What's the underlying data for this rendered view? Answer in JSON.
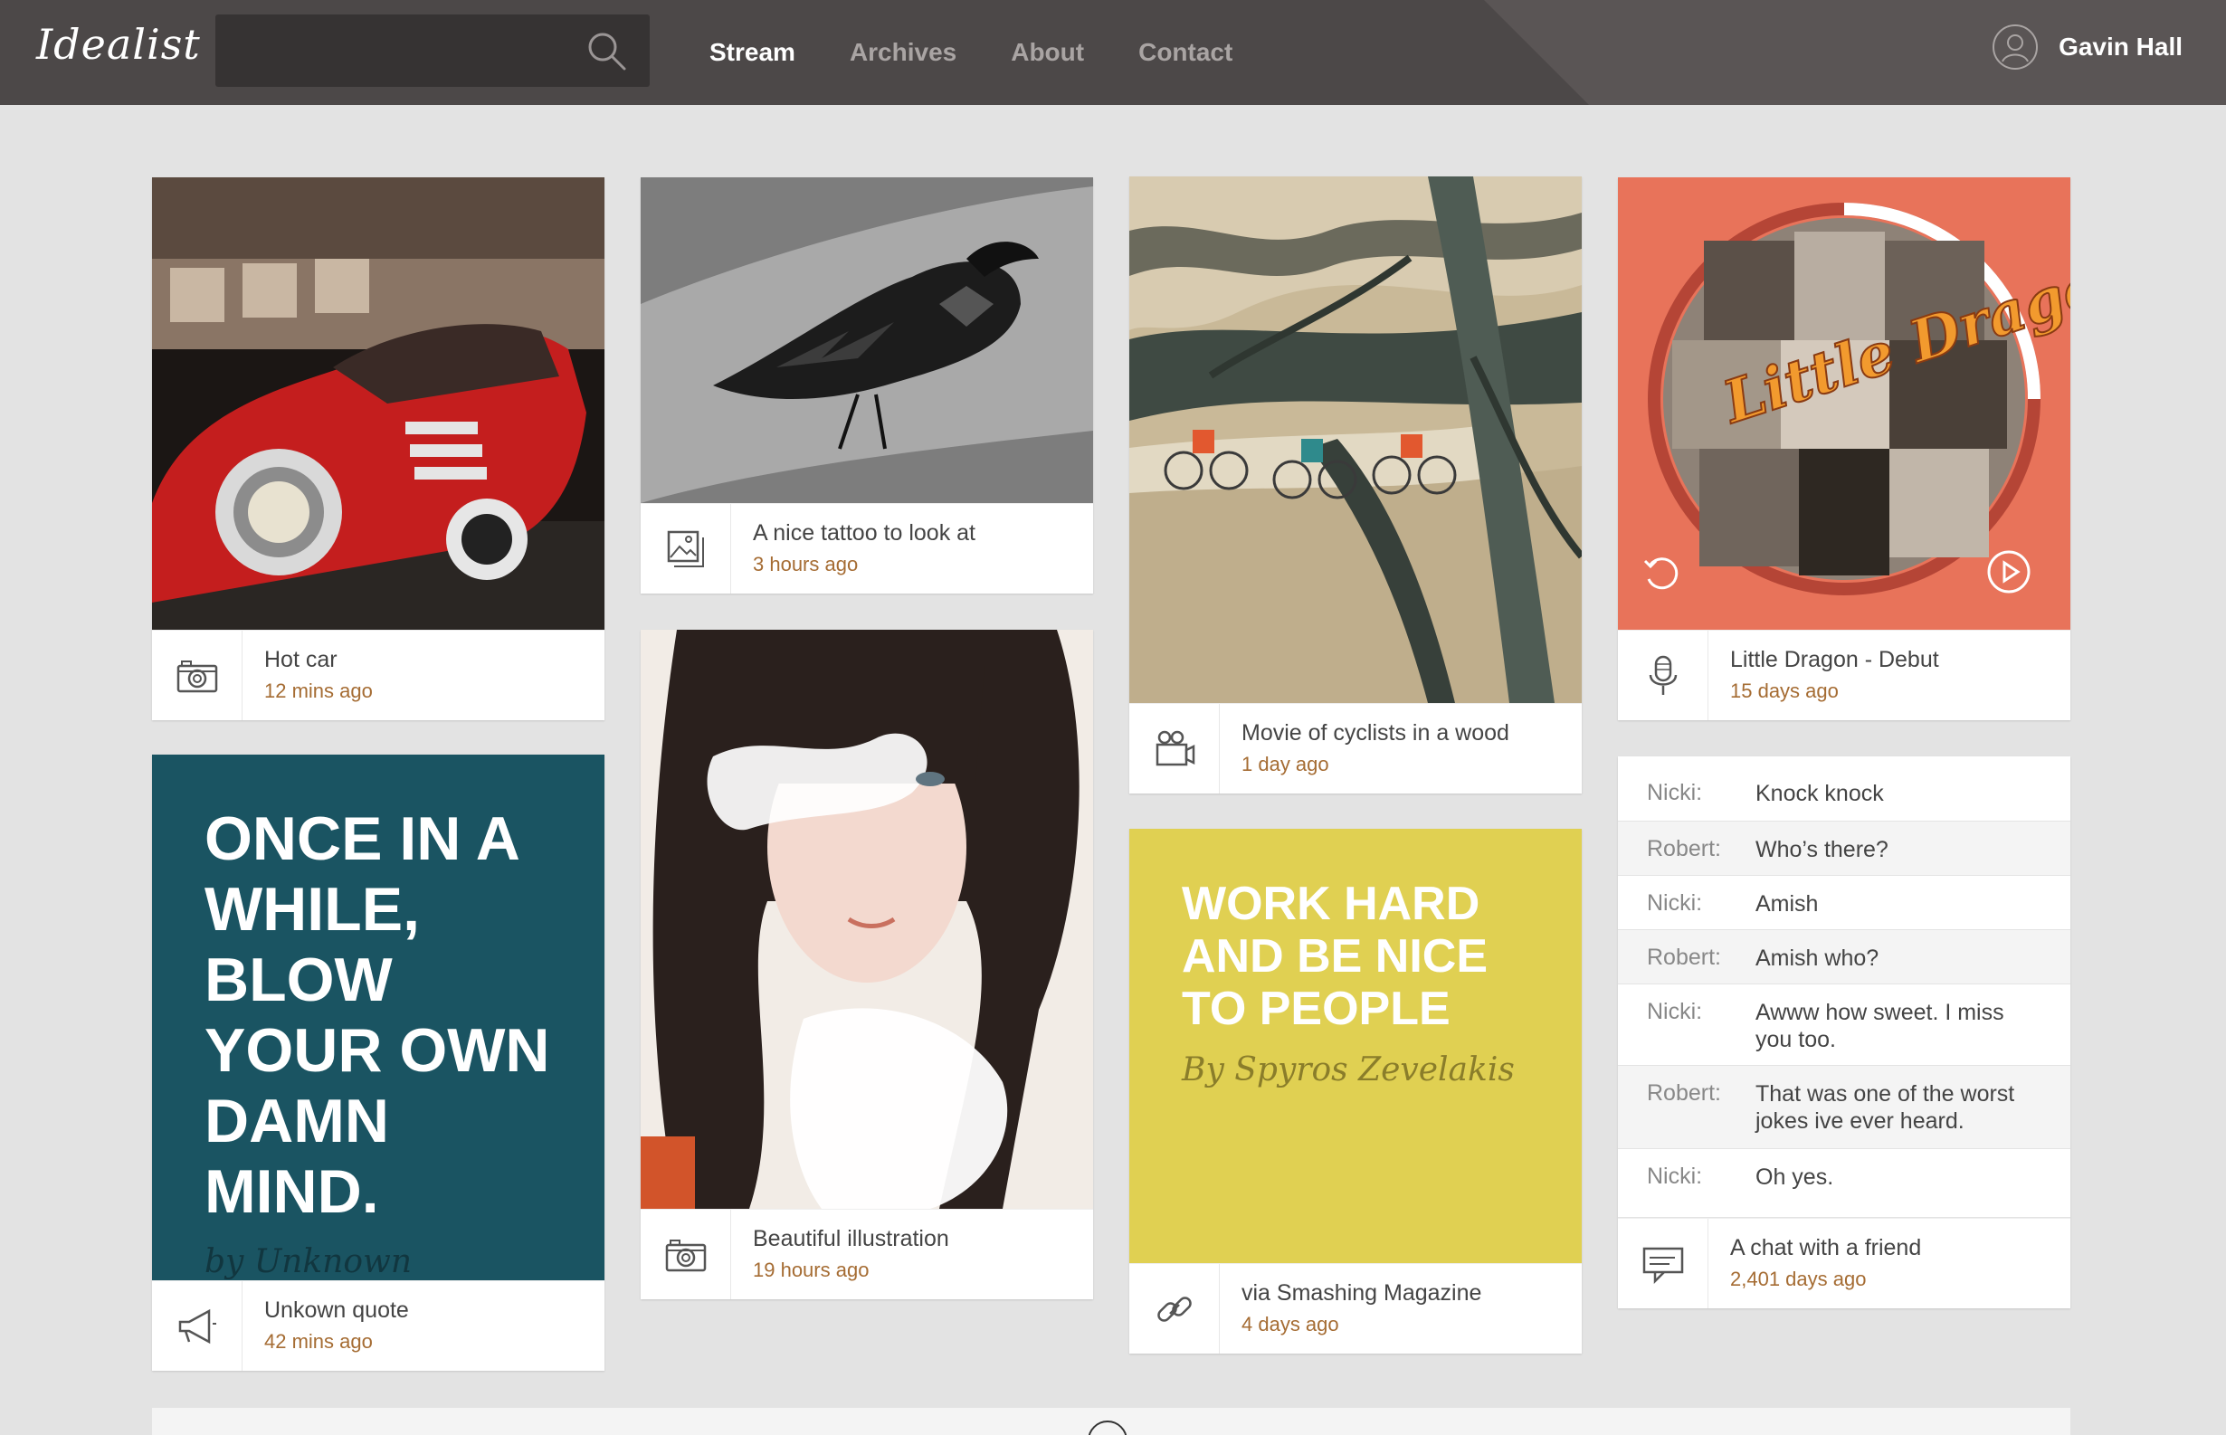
{
  "app": {
    "logo": "Idealist",
    "search": {
      "placeholder": "",
      "value": ""
    },
    "nav": [
      {
        "label": "Stream",
        "active": true
      },
      {
        "label": "Archives",
        "active": false
      },
      {
        "label": "About",
        "active": false
      },
      {
        "label": "Contact",
        "active": false
      }
    ],
    "user": {
      "name": "Gavin Hall"
    }
  },
  "cards": {
    "hot_car": {
      "title": "Hot car",
      "time": "12 mins ago",
      "icon": "camera-icon"
    },
    "tattoo": {
      "title": "A nice tattoo to look at",
      "time": "3 hours ago",
      "icon": "image-icon"
    },
    "cyclists": {
      "title": "Movie of cyclists in a wood",
      "time": "1 day ago",
      "icon": "video-camera-icon"
    },
    "little_dragon": {
      "title": "Little Dragon - Debut",
      "time": "15 days ago",
      "icon": "microphone-icon",
      "album_text": "Little Dragon"
    },
    "quote_unknown": {
      "quote": "ONCE IN A WHILE, BLOW YOUR OWN DAMN MIND.",
      "author": "by Unknown",
      "title": "Unkown quote",
      "time": "42 mins ago",
      "icon": "megaphone-icon",
      "color": "#1a5462"
    },
    "illustration": {
      "title": "Beautiful illustration",
      "time": "19 hours ago",
      "icon": "camera-icon"
    },
    "work_hard": {
      "quote": "WORK HARD AND BE NICE TO PEOPLE",
      "author": "By Spyros Zevelakis",
      "title": "via Smashing Magazine",
      "time": "4 days ago",
      "icon": "link-icon",
      "color": "#e0d052"
    },
    "chat": {
      "lines": [
        {
          "who": "Nicki:",
          "msg": "Knock knock"
        },
        {
          "who": "Robert:",
          "msg": "Who’s there?"
        },
        {
          "who": "Nicki:",
          "msg": "Amish"
        },
        {
          "who": "Robert:",
          "msg": "Amish who?"
        },
        {
          "who": "Nicki:",
          "msg": "Awww how sweet. I miss you too."
        },
        {
          "who": "Robert:",
          "msg": "That was one of the worst jokes ive ever heard."
        },
        {
          "who": "Nicki:",
          "msg": "Oh yes."
        }
      ],
      "title": "A chat with a friend",
      "time": "2,401 days ago",
      "icon": "chat-icon"
    }
  },
  "colors": {
    "topbar": "#4c4848",
    "background": "#e3e3e3",
    "accent_time": "#a56c33",
    "music_card": "#e8735a"
  }
}
